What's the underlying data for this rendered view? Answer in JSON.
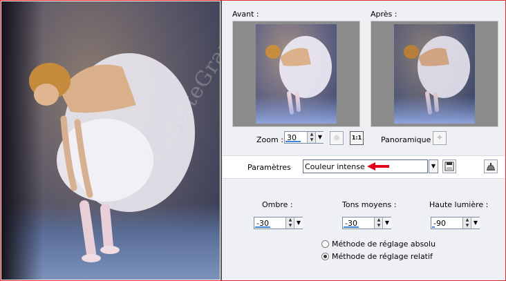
{
  "watermark": "VioletteGraphic",
  "preview": {
    "before_label": "Avant :",
    "after_label": "Après :"
  },
  "zoom": {
    "label": "Zoom :",
    "value": "30",
    "fit_icon": "fit-window-icon",
    "actual_size_label": "1:1"
  },
  "pan": {
    "label": "Panoramique :",
    "icon": "pan-move-icon"
  },
  "settings": {
    "label": "Paramètres",
    "preset_value": "Couleur intense",
    "save_icon": "save-disk-icon",
    "reset_icon": "reset-stamp-icon",
    "arrow_color": "#e3001b"
  },
  "adjust": {
    "shadows": {
      "label": "Ombre :",
      "value": "-30"
    },
    "midtones": {
      "label": "Tons moyens :",
      "value": "-30"
    },
    "highlights": {
      "label": "Haute lumière :",
      "value": "-90"
    }
  },
  "method": {
    "absolute_label": "Méthode de réglage absolu",
    "relative_label": "Méthode de réglage relatif",
    "selected": "relative"
  }
}
